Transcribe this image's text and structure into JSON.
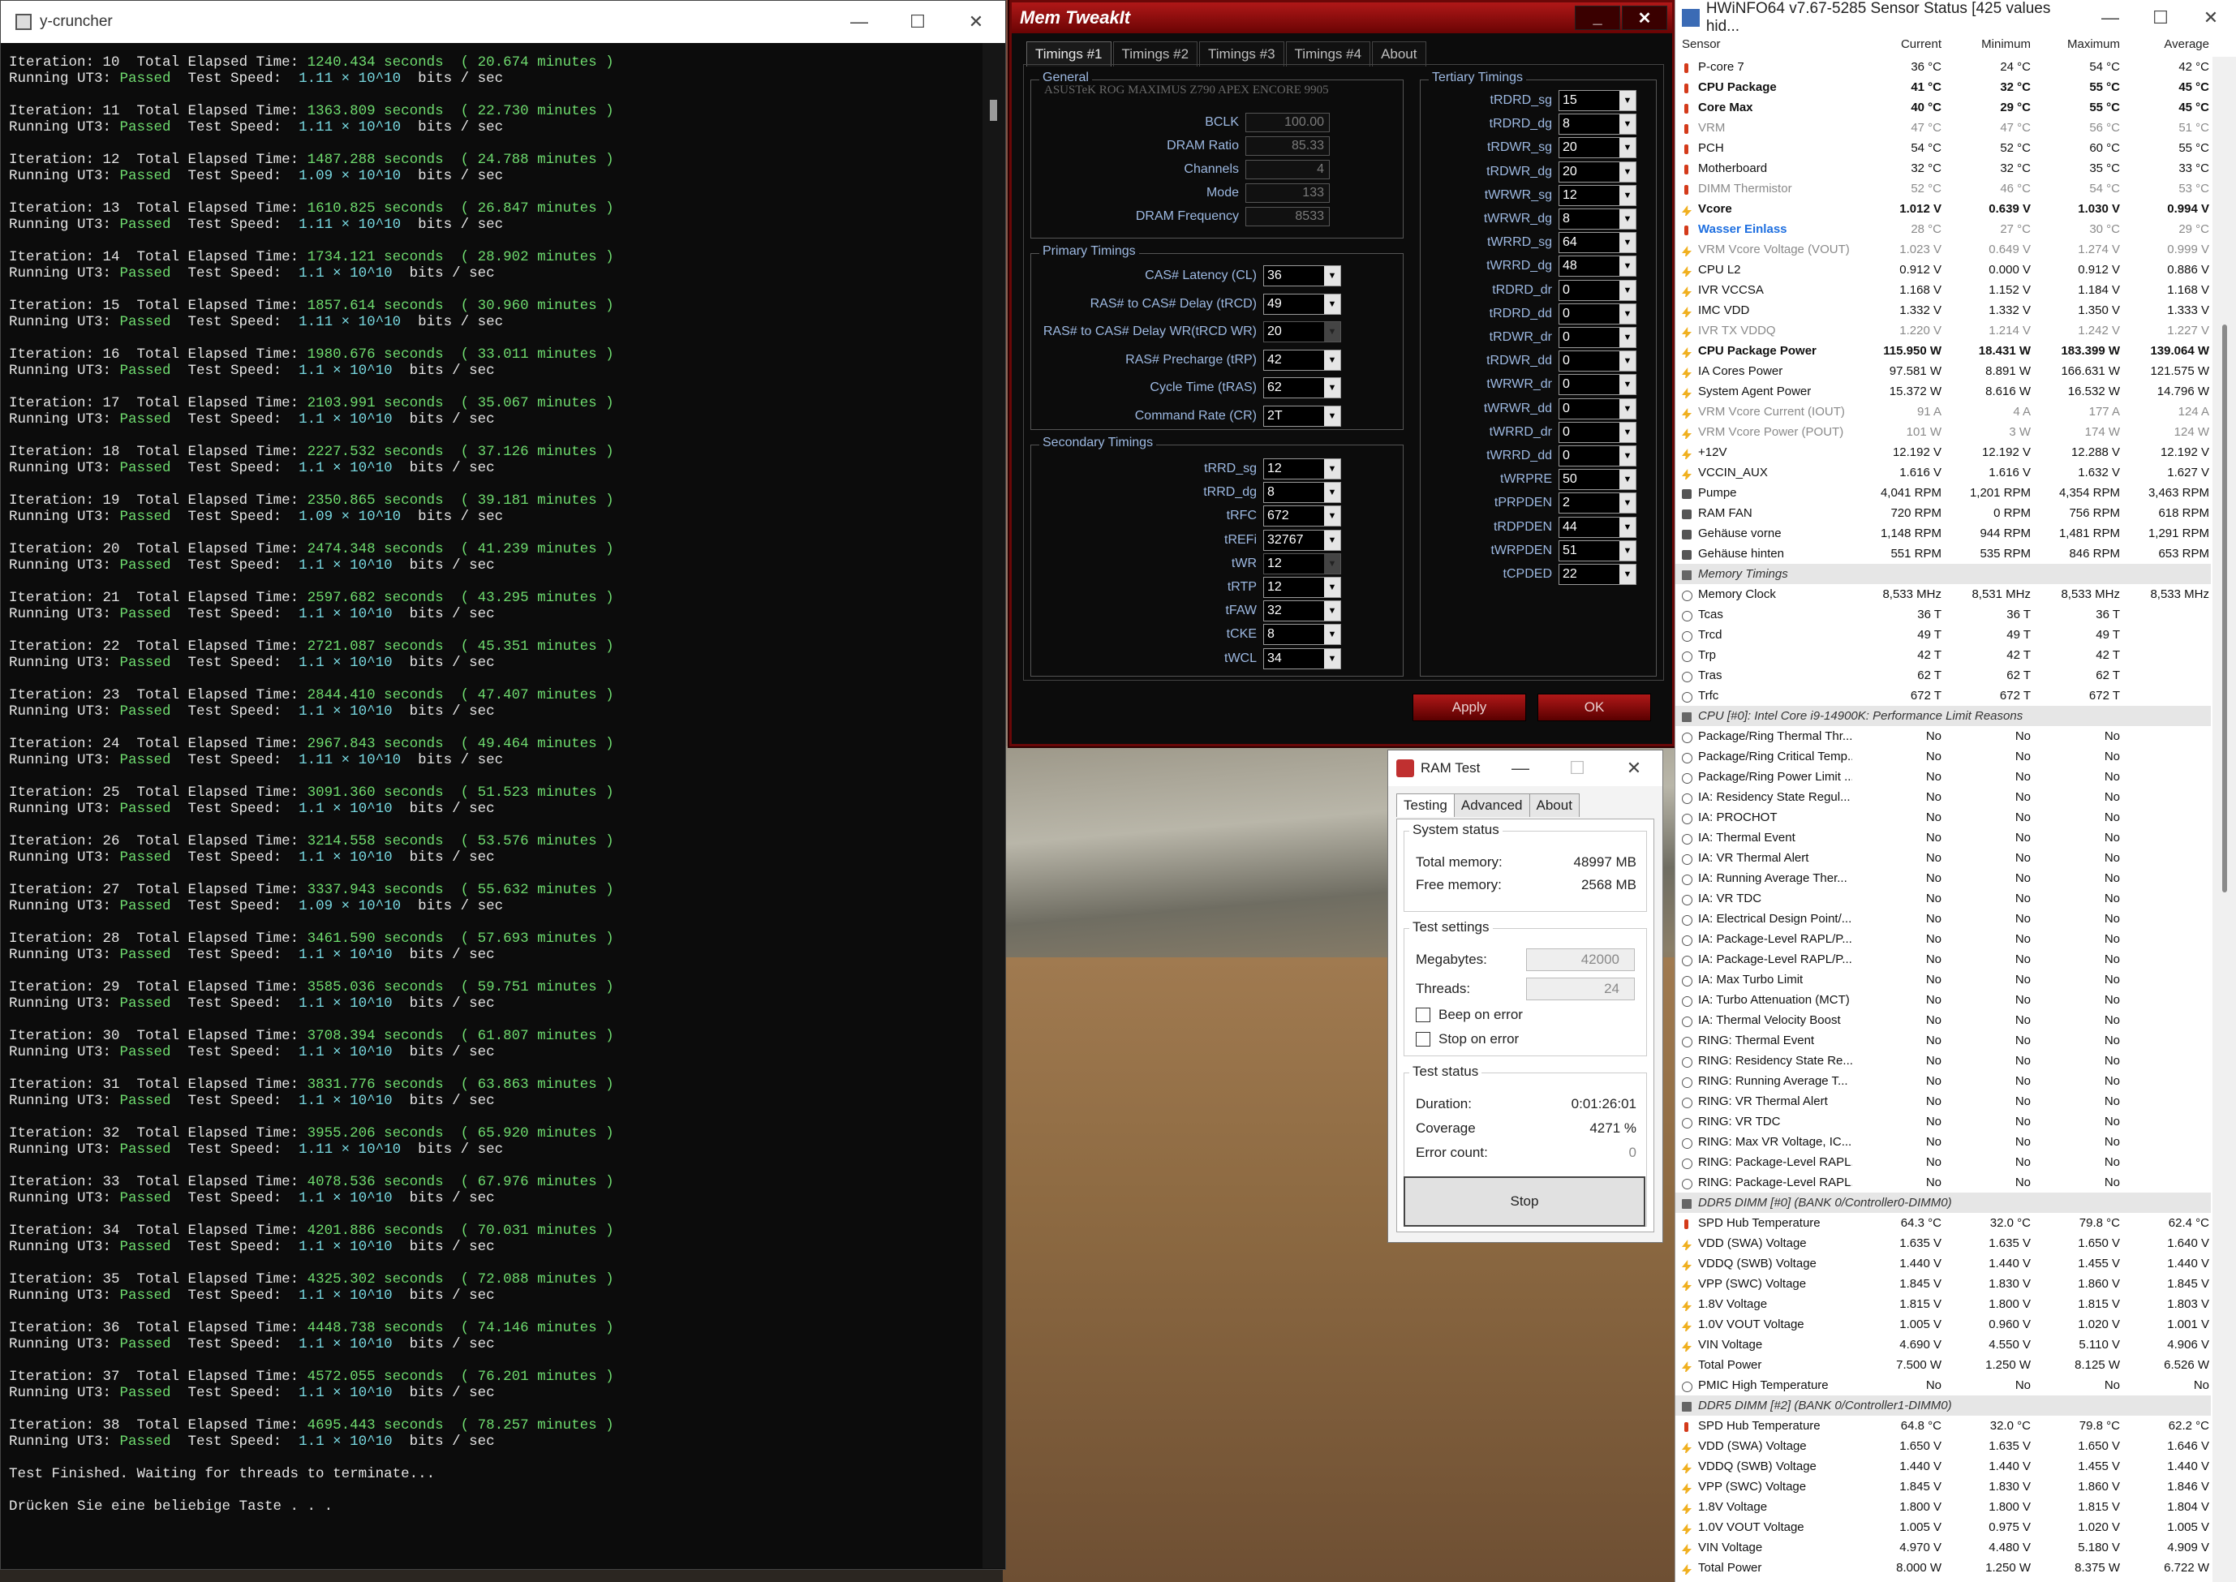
{
  "ycruncher": {
    "title": "y-cruncher",
    "iterations": [
      {
        "n": "10",
        "t": "1240.434",
        "m": "20.674",
        "s": "1.11 × 10^10"
      },
      {
        "n": "11",
        "t": "1363.809",
        "m": "22.730",
        "s": "1.11 × 10^10"
      },
      {
        "n": "12",
        "t": "1487.288",
        "m": "24.788",
        "s": "1.09 × 10^10"
      },
      {
        "n": "13",
        "t": "1610.825",
        "m": "26.847",
        "s": "1.11 × 10^10"
      },
      {
        "n": "14",
        "t": "1734.121",
        "m": "28.902",
        "s": "1.1 × 10^10"
      },
      {
        "n": "15",
        "t": "1857.614",
        "m": "30.960",
        "s": "1.11 × 10^10"
      },
      {
        "n": "16",
        "t": "1980.676",
        "m": "33.011",
        "s": "1.1 × 10^10"
      },
      {
        "n": "17",
        "t": "2103.991",
        "m": "35.067",
        "s": "1.1 × 10^10"
      },
      {
        "n": "18",
        "t": "2227.532",
        "m": "37.126",
        "s": "1.1 × 10^10"
      },
      {
        "n": "19",
        "t": "2350.865",
        "m": "39.181",
        "s": "1.09 × 10^10"
      },
      {
        "n": "20",
        "t": "2474.348",
        "m": "41.239",
        "s": "1.1 × 10^10"
      },
      {
        "n": "21",
        "t": "2597.682",
        "m": "43.295",
        "s": "1.1 × 10^10"
      },
      {
        "n": "22",
        "t": "2721.087",
        "m": "45.351",
        "s": "1.1 × 10^10"
      },
      {
        "n": "23",
        "t": "2844.410",
        "m": "47.407",
        "s": "1.1 × 10^10"
      },
      {
        "n": "24",
        "t": "2967.843",
        "m": "49.464",
        "s": "1.11 × 10^10"
      },
      {
        "n": "25",
        "t": "3091.360",
        "m": "51.523",
        "s": "1.1 × 10^10"
      },
      {
        "n": "26",
        "t": "3214.558",
        "m": "53.576",
        "s": "1.1 × 10^10"
      },
      {
        "n": "27",
        "t": "3337.943",
        "m": "55.632",
        "s": "1.09 × 10^10"
      },
      {
        "n": "28",
        "t": "3461.590",
        "m": "57.693",
        "s": "1.1 × 10^10"
      },
      {
        "n": "29",
        "t": "3585.036",
        "m": "59.751",
        "s": "1.1 × 10^10"
      },
      {
        "n": "30",
        "t": "3708.394",
        "m": "61.807",
        "s": "1.1 × 10^10"
      },
      {
        "n": "31",
        "t": "3831.776",
        "m": "63.863",
        "s": "1.1 × 10^10"
      },
      {
        "n": "32",
        "t": "3955.206",
        "m": "65.920",
        "s": "1.11 × 10^10"
      },
      {
        "n": "33",
        "t": "4078.536",
        "m": "67.976",
        "s": "1.1 × 10^10"
      },
      {
        "n": "34",
        "t": "4201.886",
        "m": "70.031",
        "s": "1.1 × 10^10"
      },
      {
        "n": "35",
        "t": "4325.302",
        "m": "72.088",
        "s": "1.1 × 10^10"
      },
      {
        "n": "36",
        "t": "4448.738",
        "m": "74.146",
        "s": "1.1 × 10^10"
      },
      {
        "n": "37",
        "t": "4572.055",
        "m": "76.201",
        "s": "1.1 × 10^10"
      },
      {
        "n": "38",
        "t": "4695.443",
        "m": "78.257",
        "s": "1.1 × 10^10"
      }
    ],
    "finished": "Test Finished. Waiting for threads to terminate...",
    "prompt": "Drücken Sie eine beliebige Taste . . ."
  },
  "memtweak": {
    "title": "Mem TweakIt",
    "tabs": [
      "Timings #1",
      "Timings #2",
      "Timings #3",
      "Timings #4",
      "About"
    ],
    "general": {
      "title": "General",
      "board": "ASUSTeK ROG MAXIMUS Z790 APEX ENCORE 9905",
      "fields": [
        {
          "l": "BCLK",
          "v": "100.00"
        },
        {
          "l": "DRAM Ratio",
          "v": "85.33"
        },
        {
          "l": "Channels",
          "v": "4"
        },
        {
          "l": "Mode",
          "v": "133"
        },
        {
          "l": "DRAM Frequency",
          "v": "8533"
        }
      ]
    },
    "primary": {
      "title": "Primary Timings",
      "fields": [
        {
          "l": "CAS# Latency (CL)",
          "v": "36"
        },
        {
          "l": "RAS# to CAS# Delay (tRCD)",
          "v": "49"
        },
        {
          "l": "RAS# to CAS# Delay WR(tRCD WR)",
          "v": "20",
          "dis": true
        },
        {
          "l": "RAS# Precharge (tRP)",
          "v": "42"
        },
        {
          "l": "Cycle Time (tRAS)",
          "v": "62"
        },
        {
          "l": "Command Rate (CR)",
          "v": "2T"
        }
      ]
    },
    "secondary": {
      "title": "Secondary Timings",
      "fields": [
        {
          "l": "tRRD_sg",
          "v": "12"
        },
        {
          "l": "tRRD_dg",
          "v": "8"
        },
        {
          "l": "tRFC",
          "v": "672"
        },
        {
          "l": "tREFi",
          "v": "32767"
        },
        {
          "l": "tWR",
          "v": "12",
          "dis": true
        },
        {
          "l": "tRTP",
          "v": "12"
        },
        {
          "l": "tFAW",
          "v": "32"
        },
        {
          "l": "tCKE",
          "v": "8"
        },
        {
          "l": "tWCL",
          "v": "34"
        }
      ]
    },
    "tertiary": {
      "title": "Tertiary Timings",
      "fields": [
        {
          "l": "tRDRD_sg",
          "v": "15"
        },
        {
          "l": "tRDRD_dg",
          "v": "8"
        },
        {
          "l": "tRDWR_sg",
          "v": "20"
        },
        {
          "l": "tRDWR_dg",
          "v": "20"
        },
        {
          "l": "tWRWR_sg",
          "v": "12"
        },
        {
          "l": "tWRWR_dg",
          "v": "8"
        },
        {
          "l": "tWRRD_sg",
          "v": "64"
        },
        {
          "l": "tWRRD_dg",
          "v": "48"
        },
        {
          "l": "tRDRD_dr",
          "v": "0"
        },
        {
          "l": "tRDRD_dd",
          "v": "0"
        },
        {
          "l": "tRDWR_dr",
          "v": "0"
        },
        {
          "l": "tRDWR_dd",
          "v": "0"
        },
        {
          "l": "tWRWR_dr",
          "v": "0"
        },
        {
          "l": "tWRWR_dd",
          "v": "0"
        },
        {
          "l": "tWRRD_dr",
          "v": "0"
        },
        {
          "l": "tWRRD_dd",
          "v": "0"
        },
        {
          "l": "tWRPRE",
          "v": "50"
        },
        {
          "l": "tPRPDEN",
          "v": "2"
        },
        {
          "l": "tRDPDEN",
          "v": "44"
        },
        {
          "l": "tWRPDEN",
          "v": "51"
        },
        {
          "l": "tCPDED",
          "v": "22"
        }
      ]
    },
    "apply": "Apply",
    "ok": "OK"
  },
  "ramtest": {
    "title": "RAM Test",
    "tabs": [
      "Testing",
      "Advanced",
      "About"
    ],
    "system_status": "System status",
    "total_memory_label": "Total memory:",
    "total_memory": "48997 MB",
    "free_memory_label": "Free memory:",
    "free_memory": "2568 MB",
    "test_settings": "Test settings",
    "megabytes_label": "Megabytes:",
    "megabytes": "42000",
    "threads_label": "Threads:",
    "threads": "24",
    "beep": "Beep on error",
    "stop_on_error": "Stop on error",
    "test_status": "Test status",
    "duration_label": "Duration:",
    "duration": "0:01:26:01",
    "coverage_label": "Coverage",
    "coverage": "4271 %",
    "errors_label": "Error count:",
    "errors": "0",
    "stop": "Stop"
  },
  "hwinfo": {
    "title": "HWiNFO64 v7.67-5285 Sensor Status [425 values hid...",
    "headers": [
      "Sensor",
      "Current",
      "Minimum",
      "Maximum",
      "Average"
    ],
    "rows": [
      {
        "k": "t",
        "n": "P-core 7",
        "c": "36 °C",
        "mi": "24 °C",
        "ma": "54 °C",
        "a": "42 °C"
      },
      {
        "k": "t b",
        "n": "CPU Package",
        "c": "41 °C",
        "mi": "32 °C",
        "ma": "55 °C",
        "a": "45 °C"
      },
      {
        "k": "t b",
        "n": "Core Max",
        "c": "40 °C",
        "mi": "29 °C",
        "ma": "55 °C",
        "a": "45 °C"
      },
      {
        "k": "t gray",
        "n": "VRM",
        "c": "47 °C",
        "mi": "47 °C",
        "ma": "56 °C",
        "a": "51 °C"
      },
      {
        "k": "t",
        "n": "PCH",
        "c": "54 °C",
        "mi": "52 °C",
        "ma": "60 °C",
        "a": "55 °C"
      },
      {
        "k": "t",
        "n": "Motherboard",
        "c": "32 °C",
        "mi": "32 °C",
        "ma": "35 °C",
        "a": "33 °C"
      },
      {
        "k": "t gray",
        "n": "DIMM Thermistor",
        "c": "52 °C",
        "mi": "46 °C",
        "ma": "54 °C",
        "a": "53 °C"
      },
      {
        "k": "v1 b",
        "n": "Vcore",
        "c": "1.012 V",
        "mi": "0.639 V",
        "ma": "1.030 V",
        "a": "0.994 V"
      },
      {
        "k": "t gray blue",
        "n": "Wasser Einlass",
        "c": "28 °C",
        "mi": "27 °C",
        "ma": "30 °C",
        "a": "29 °C"
      },
      {
        "k": "v1 gray",
        "n": "VRM Vcore Voltage (VOUT)",
        "c": "1.023 V",
        "mi": "0.649 V",
        "ma": "1.274 V",
        "a": "0.999 V"
      },
      {
        "k": "v1",
        "n": "CPU L2",
        "c": "0.912 V",
        "mi": "0.000 V",
        "ma": "0.912 V",
        "a": "0.886 V"
      },
      {
        "k": "v1",
        "n": "IVR VCCSA",
        "c": "1.168 V",
        "mi": "1.152 V",
        "ma": "1.184 V",
        "a": "1.168 V"
      },
      {
        "k": "v1",
        "n": "IMC VDD",
        "c": "1.332 V",
        "mi": "1.332 V",
        "ma": "1.350 V",
        "a": "1.333 V"
      },
      {
        "k": "v1 gray",
        "n": "IVR TX VDDQ",
        "c": "1.220 V",
        "mi": "1.214 V",
        "ma": "1.242 V",
        "a": "1.227 V"
      },
      {
        "k": "v1 b",
        "n": "CPU Package Power",
        "c": "115.950 W",
        "mi": "18.431 W",
        "ma": "183.399 W",
        "a": "139.064 W"
      },
      {
        "k": "v1",
        "n": "IA Cores Power",
        "c": "97.581 W",
        "mi": "8.891 W",
        "ma": "166.631 W",
        "a": "121.575 W"
      },
      {
        "k": "v1",
        "n": "System Agent Power",
        "c": "15.372 W",
        "mi": "8.616 W",
        "ma": "16.532 W",
        "a": "14.796 W"
      },
      {
        "k": "v1 gray",
        "n": "VRM Vcore Current (IOUT)",
        "c": "91 A",
        "mi": "4 A",
        "ma": "177 A",
        "a": "124 A"
      },
      {
        "k": "v1 gray",
        "n": "VRM Vcore Power (POUT)",
        "c": "101 W",
        "mi": "3 W",
        "ma": "174 W",
        "a": "124 W"
      },
      {
        "k": "v1",
        "n": "+12V",
        "c": "12.192 V",
        "mi": "12.192 V",
        "ma": "12.288 V",
        "a": "12.192 V"
      },
      {
        "k": "v1",
        "n": "VCCIN_AUX",
        "c": "1.616 V",
        "mi": "1.616 V",
        "ma": "1.632 V",
        "a": "1.627 V"
      },
      {
        "k": "f",
        "n": "Pumpe",
        "c": "4,041 RPM",
        "mi": "1,201 RPM",
        "ma": "4,354 RPM",
        "a": "3,463 RPM"
      },
      {
        "k": "f",
        "n": "RAM FAN",
        "c": "720 RPM",
        "mi": "0 RPM",
        "ma": "756 RPM",
        "a": "618 RPM"
      },
      {
        "k": "f",
        "n": "Gehäuse vorne",
        "c": "1,148 RPM",
        "mi": "944 RPM",
        "ma": "1,481 RPM",
        "a": "1,291 RPM"
      },
      {
        "k": "f",
        "n": "Gehäuse hinten",
        "c": "551 RPM",
        "mi": "535 RPM",
        "ma": "846 RPM",
        "a": "653 RPM"
      },
      {
        "k": "m sec",
        "n": "Memory Timings",
        "c": "",
        "mi": "",
        "ma": "",
        "a": ""
      },
      {
        "k": "k",
        "n": "Memory Clock",
        "c": "8,533 MHz",
        "mi": "8,531 MHz",
        "ma": "8,533 MHz",
        "a": "8,533 MHz"
      },
      {
        "k": "k",
        "n": "Tcas",
        "c": "36 T",
        "mi": "36 T",
        "ma": "36 T",
        "a": ""
      },
      {
        "k": "k",
        "n": "Trcd",
        "c": "49 T",
        "mi": "49 T",
        "ma": "49 T",
        "a": ""
      },
      {
        "k": "k",
        "n": "Trp",
        "c": "42 T",
        "mi": "42 T",
        "ma": "42 T",
        "a": ""
      },
      {
        "k": "k",
        "n": "Tras",
        "c": "62 T",
        "mi": "62 T",
        "ma": "62 T",
        "a": ""
      },
      {
        "k": "k",
        "n": "Trfc",
        "c": "672 T",
        "mi": "672 T",
        "ma": "672 T",
        "a": ""
      },
      {
        "k": "m sec",
        "n": "CPU [#0]: Intel Core i9-14900K: Performance Limit Reasons",
        "c": "",
        "mi": "",
        "ma": "",
        "a": ""
      },
      {
        "k": "k",
        "n": "Package/Ring Thermal Thr...",
        "c": "No",
        "mi": "No",
        "ma": "No",
        "a": ""
      },
      {
        "k": "k",
        "n": "Package/Ring Critical Temp...",
        "c": "No",
        "mi": "No",
        "ma": "No",
        "a": ""
      },
      {
        "k": "k",
        "n": "Package/Ring Power Limit ...",
        "c": "No",
        "mi": "No",
        "ma": "No",
        "a": ""
      },
      {
        "k": "k",
        "n": "IA: Residency State Regul...",
        "c": "No",
        "mi": "No",
        "ma": "No",
        "a": ""
      },
      {
        "k": "k",
        "n": "IA: PROCHOT",
        "c": "No",
        "mi": "No",
        "ma": "No",
        "a": ""
      },
      {
        "k": "k",
        "n": "IA: Thermal Event",
        "c": "No",
        "mi": "No",
        "ma": "No",
        "a": ""
      },
      {
        "k": "k",
        "n": "IA: VR Thermal Alert",
        "c": "No",
        "mi": "No",
        "ma": "No",
        "a": ""
      },
      {
        "k": "k",
        "n": "IA: Running Average Ther...",
        "c": "No",
        "mi": "No",
        "ma": "No",
        "a": ""
      },
      {
        "k": "k",
        "n": "IA: VR TDC",
        "c": "No",
        "mi": "No",
        "ma": "No",
        "a": ""
      },
      {
        "k": "k",
        "n": "IA: Electrical Design Point/...",
        "c": "No",
        "mi": "No",
        "ma": "No",
        "a": ""
      },
      {
        "k": "k",
        "n": "IA: Package-Level RAPL/P...",
        "c": "No",
        "mi": "No",
        "ma": "No",
        "a": ""
      },
      {
        "k": "k",
        "n": "IA: Package-Level RAPL/P...",
        "c": "No",
        "mi": "No",
        "ma": "No",
        "a": ""
      },
      {
        "k": "k",
        "n": "IA: Max Turbo Limit",
        "c": "No",
        "mi": "No",
        "ma": "No",
        "a": ""
      },
      {
        "k": "k",
        "n": "IA: Turbo Attenuation (MCT)",
        "c": "No",
        "mi": "No",
        "ma": "No",
        "a": ""
      },
      {
        "k": "k",
        "n": "IA: Thermal Velocity Boost",
        "c": "No",
        "mi": "No",
        "ma": "No",
        "a": ""
      },
      {
        "k": "k",
        "n": "RING: Thermal Event",
        "c": "No",
        "mi": "No",
        "ma": "No",
        "a": ""
      },
      {
        "k": "k",
        "n": "RING: Residency State Re...",
        "c": "No",
        "mi": "No",
        "ma": "No",
        "a": ""
      },
      {
        "k": "k",
        "n": "RING: Running Average T...",
        "c": "No",
        "mi": "No",
        "ma": "No",
        "a": ""
      },
      {
        "k": "k",
        "n": "RING: VR Thermal Alert",
        "c": "No",
        "mi": "No",
        "ma": "No",
        "a": ""
      },
      {
        "k": "k",
        "n": "RING: VR TDC",
        "c": "No",
        "mi": "No",
        "ma": "No",
        "a": ""
      },
      {
        "k": "k",
        "n": "RING: Max VR Voltage, IC...",
        "c": "No",
        "mi": "No",
        "ma": "No",
        "a": ""
      },
      {
        "k": "k",
        "n": "RING: Package-Level RAPL...",
        "c": "No",
        "mi": "No",
        "ma": "No",
        "a": ""
      },
      {
        "k": "k",
        "n": "RING: Package-Level RAPL...",
        "c": "No",
        "mi": "No",
        "ma": "No",
        "a": ""
      },
      {
        "k": "m sec",
        "n": "DDR5 DIMM [#0] (BANK 0/Controller0-DIMM0)",
        "c": "",
        "mi": "",
        "ma": "",
        "a": ""
      },
      {
        "k": "t",
        "n": "SPD Hub Temperature",
        "c": "64.3 °C",
        "mi": "32.0 °C",
        "ma": "79.8 °C",
        "a": "62.4 °C"
      },
      {
        "k": "v1",
        "n": "VDD (SWA) Voltage",
        "c": "1.635 V",
        "mi": "1.635 V",
        "ma": "1.650 V",
        "a": "1.640 V"
      },
      {
        "k": "v1",
        "n": "VDDQ (SWB) Voltage",
        "c": "1.440 V",
        "mi": "1.440 V",
        "ma": "1.455 V",
        "a": "1.440 V"
      },
      {
        "k": "v1",
        "n": "VPP (SWC) Voltage",
        "c": "1.845 V",
        "mi": "1.830 V",
        "ma": "1.860 V",
        "a": "1.845 V"
      },
      {
        "k": "v1",
        "n": "1.8V Voltage",
        "c": "1.815 V",
        "mi": "1.800 V",
        "ma": "1.815 V",
        "a": "1.803 V"
      },
      {
        "k": "v1",
        "n": "1.0V VOUT Voltage",
        "c": "1.005 V",
        "mi": "0.960 V",
        "ma": "1.020 V",
        "a": "1.001 V"
      },
      {
        "k": "v1",
        "n": "VIN Voltage",
        "c": "4.690 V",
        "mi": "4.550 V",
        "ma": "5.110 V",
        "a": "4.906 V"
      },
      {
        "k": "v1",
        "n": "Total Power",
        "c": "7.500 W",
        "mi": "1.250 W",
        "ma": "8.125 W",
        "a": "6.526 W"
      },
      {
        "k": "k",
        "n": "PMIC High Temperature",
        "c": "No",
        "mi": "No",
        "ma": "No",
        "a": "No"
      },
      {
        "k": "m sec",
        "n": "DDR5 DIMM [#2] (BANK 0/Controller1-DIMM0)",
        "c": "",
        "mi": "",
        "ma": "",
        "a": ""
      },
      {
        "k": "t",
        "n": "SPD Hub Temperature",
        "c": "64.8 °C",
        "mi": "32.0 °C",
        "ma": "79.8 °C",
        "a": "62.2 °C"
      },
      {
        "k": "v1",
        "n": "VDD (SWA) Voltage",
        "c": "1.650 V",
        "mi": "1.635 V",
        "ma": "1.650 V",
        "a": "1.646 V"
      },
      {
        "k": "v1",
        "n": "VDDQ (SWB) Voltage",
        "c": "1.440 V",
        "mi": "1.440 V",
        "ma": "1.455 V",
        "a": "1.440 V"
      },
      {
        "k": "v1",
        "n": "VPP (SWC) Voltage",
        "c": "1.845 V",
        "mi": "1.830 V",
        "ma": "1.860 V",
        "a": "1.846 V"
      },
      {
        "k": "v1",
        "n": "1.8V Voltage",
        "c": "1.800 V",
        "mi": "1.800 V",
        "ma": "1.815 V",
        "a": "1.804 V"
      },
      {
        "k": "v1",
        "n": "1.0V VOUT Voltage",
        "c": "1.005 V",
        "mi": "0.975 V",
        "ma": "1.020 V",
        "a": "1.005 V"
      },
      {
        "k": "v1",
        "n": "VIN Voltage",
        "c": "4.970 V",
        "mi": "4.480 V",
        "ma": "5.180 V",
        "a": "4.909 V"
      },
      {
        "k": "v1",
        "n": "Total Power",
        "c": "8.000 W",
        "mi": "1.250 W",
        "ma": "8.375 W",
        "a": "6.722 W"
      }
    ]
  }
}
